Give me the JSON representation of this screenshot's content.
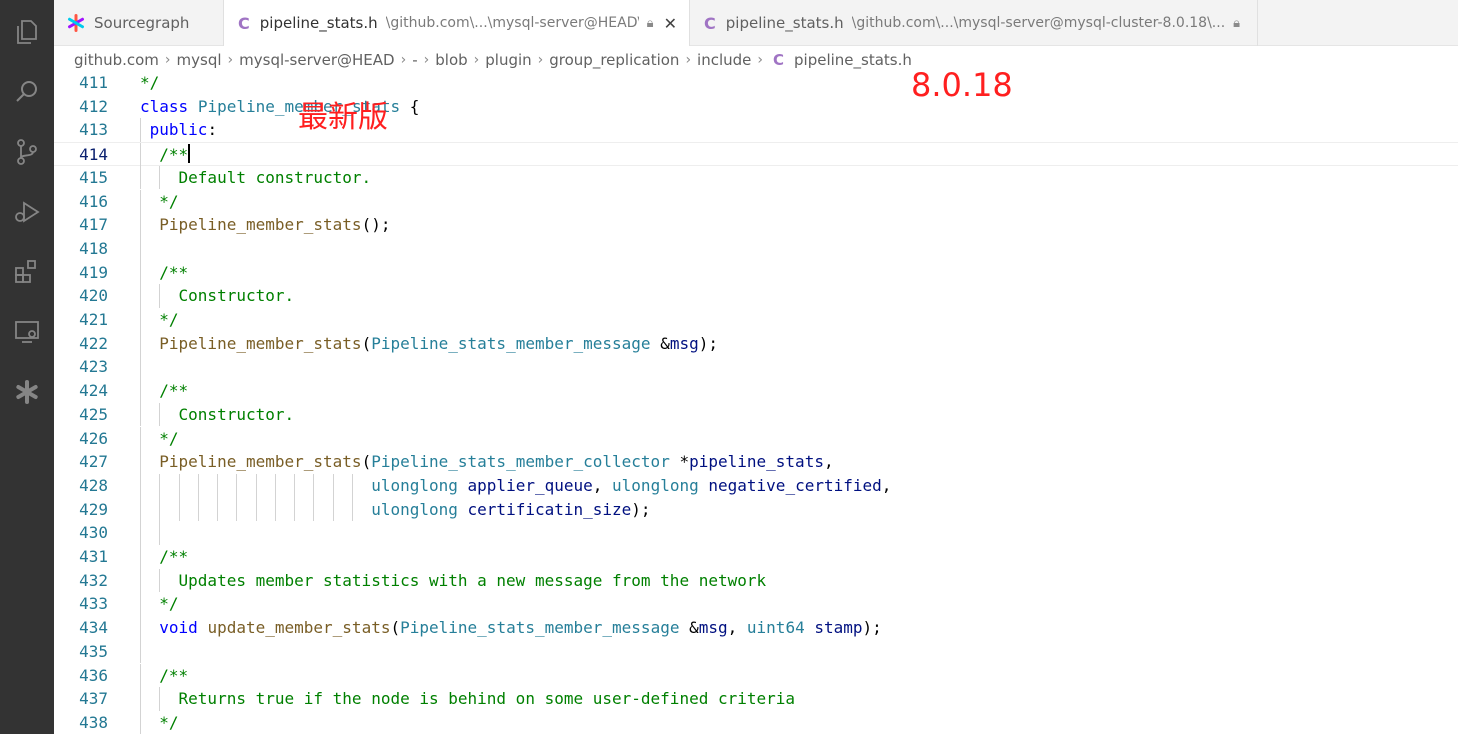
{
  "tabs": [
    {
      "icon": "sourcegraph-logo",
      "title": "Sourcegraph",
      "desc": "",
      "active": false
    },
    {
      "icon": "c-lang-icon",
      "title": "pipeline_stats.h",
      "desc": "\\github.com\\...\\mysql-server@HEAD\\...",
      "active": true
    },
    {
      "icon": "c-lang-icon",
      "title": "pipeline_stats.h",
      "desc": "\\github.com\\...\\mysql-server@mysql-cluster-8.0.18\\...",
      "active": false
    }
  ],
  "c_icon_glyph": "C",
  "breadcrumb": [
    "github.com",
    "mysql",
    "mysql-server@HEAD",
    "-",
    "blob",
    "plugin",
    "group_replication",
    "include"
  ],
  "breadcrumb_file": "pipeline_stats.h",
  "annotations": {
    "left": "最新版",
    "right": "8.0.18"
  },
  "colors": {
    "activity_bar": "#333333",
    "c_icon": "#a074c4",
    "annotation": "#ff1f1f",
    "line_number": "#237893"
  },
  "lines": [
    {
      "n": "411",
      "tokens": [
        [
          "cm",
          "*/"
        ]
      ]
    },
    {
      "n": "412",
      "tokens": [
        [
          "kw",
          "class"
        ],
        [
          "",
          " "
        ],
        [
          "ty",
          "Pipeline_member_stats"
        ],
        [
          "",
          " {"
        ]
      ]
    },
    {
      "n": "413",
      "tokens": [
        [
          "kw",
          " public"
        ],
        [
          "",
          ":"
        ]
      ]
    },
    {
      "n": "414",
      "tokens": [
        [
          "cm",
          "  /**"
        ]
      ],
      "current": true
    },
    {
      "n": "415",
      "tokens": [
        [
          "cm",
          "    Default constructor."
        ]
      ]
    },
    {
      "n": "416",
      "tokens": [
        [
          "cm",
          "  */"
        ]
      ]
    },
    {
      "n": "417",
      "tokens": [
        [
          "fn",
          "  Pipeline_member_stats"
        ],
        [
          "",
          "();"
        ]
      ]
    },
    {
      "n": "418",
      "tokens": []
    },
    {
      "n": "419",
      "tokens": [
        [
          "cm",
          "  /**"
        ]
      ]
    },
    {
      "n": "420",
      "tokens": [
        [
          "cm",
          "    Constructor."
        ]
      ]
    },
    {
      "n": "421",
      "tokens": [
        [
          "cm",
          "  */"
        ]
      ]
    },
    {
      "n": "422",
      "tokens": [
        [
          "fn",
          "  Pipeline_member_stats"
        ],
        [
          "",
          "("
        ],
        [
          "ty",
          "Pipeline_stats_member_message"
        ],
        [
          "",
          " &"
        ],
        [
          "vr",
          "msg"
        ],
        [
          "",
          ");"
        ]
      ]
    },
    {
      "n": "423",
      "tokens": []
    },
    {
      "n": "424",
      "tokens": [
        [
          "cm",
          "  /**"
        ]
      ]
    },
    {
      "n": "425",
      "tokens": [
        [
          "cm",
          "    Constructor."
        ]
      ]
    },
    {
      "n": "426",
      "tokens": [
        [
          "cm",
          "  */"
        ]
      ]
    },
    {
      "n": "427",
      "tokens": [
        [
          "fn",
          "  Pipeline_member_stats"
        ],
        [
          "",
          "("
        ],
        [
          "ty",
          "Pipeline_stats_member_collector"
        ],
        [
          "",
          " *"
        ],
        [
          "vr",
          "pipeline_stats"
        ],
        [
          "",
          ","
        ]
      ]
    },
    {
      "n": "428",
      "tokens": [
        [
          "",
          "                        "
        ],
        [
          "ty",
          "ulonglong"
        ],
        [
          "",
          " "
        ],
        [
          "vr",
          "applier_queue"
        ],
        [
          "",
          ", "
        ],
        [
          "ty",
          "ulonglong"
        ],
        [
          "",
          " "
        ],
        [
          "vr",
          "negative_certified"
        ],
        [
          "",
          ","
        ]
      ]
    },
    {
      "n": "429",
      "tokens": [
        [
          "",
          "                        "
        ],
        [
          "ty",
          "ulonglong"
        ],
        [
          "",
          " "
        ],
        [
          "vr",
          "certificatin_size"
        ],
        [
          "",
          ");"
        ]
      ]
    },
    {
      "n": "430",
      "tokens": []
    },
    {
      "n": "431",
      "tokens": [
        [
          "cm",
          "  /**"
        ]
      ]
    },
    {
      "n": "432",
      "tokens": [
        [
          "cm",
          "    Updates member statistics with a new message from the network"
        ]
      ]
    },
    {
      "n": "433",
      "tokens": [
        [
          "cm",
          "  */"
        ]
      ]
    },
    {
      "n": "434",
      "tokens": [
        [
          "kw",
          "  void"
        ],
        [
          "",
          " "
        ],
        [
          "fn",
          "update_member_stats"
        ],
        [
          "",
          "("
        ],
        [
          "ty",
          "Pipeline_stats_member_message"
        ],
        [
          "",
          " &"
        ],
        [
          "vr",
          "msg"
        ],
        [
          "",
          ", "
        ],
        [
          "ty",
          "uint64"
        ],
        [
          "",
          " "
        ],
        [
          "vr",
          "stamp"
        ],
        [
          "",
          ");"
        ]
      ]
    },
    {
      "n": "435",
      "tokens": []
    },
    {
      "n": "436",
      "tokens": [
        [
          "cm",
          "  /**"
        ]
      ]
    },
    {
      "n": "437",
      "tokens": [
        [
          "cm",
          "    Returns true if the node is behind on some user-defined criteria"
        ]
      ]
    },
    {
      "n": "438",
      "tokens": [
        [
          "cm",
          "  */"
        ]
      ]
    }
  ]
}
